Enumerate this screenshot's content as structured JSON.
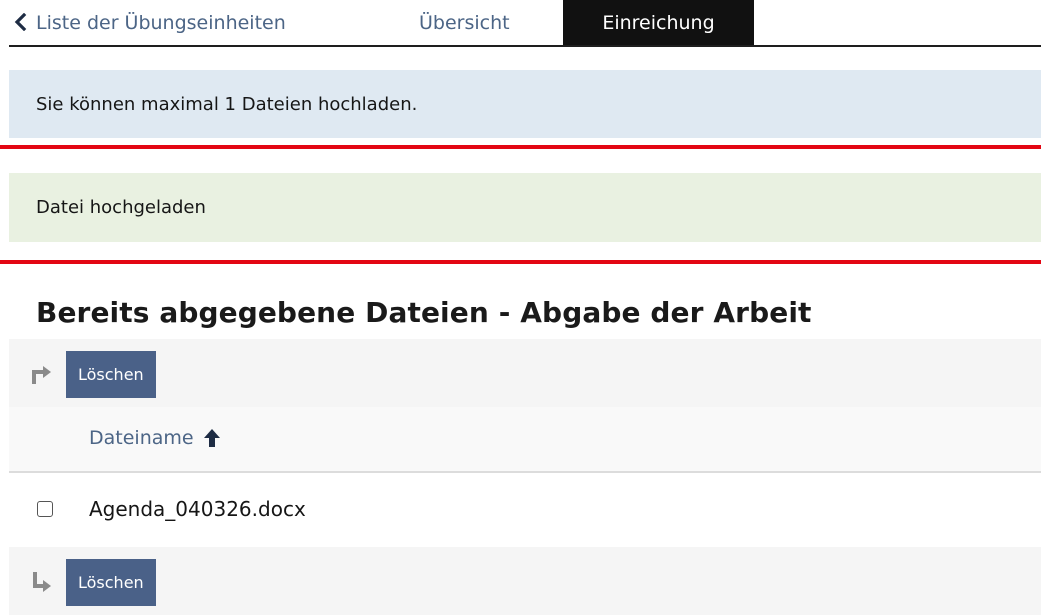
{
  "tabs": {
    "back_label": "Liste der Übungseinheiten",
    "overview_label": "Übersicht",
    "active_label": "Einreichung"
  },
  "messages": {
    "info": "Sie können maximal 1 Dateien hochladen.",
    "success": "Datei hochgeladen"
  },
  "section": {
    "title": "Bereits abgegebene Dateien - Abgabe der Arbeit"
  },
  "table": {
    "top_action_label": "Löschen",
    "bottom_action_label": "Löschen",
    "column_header": "Dateiname",
    "sort_icon": "arrow-up-icon",
    "rows": [
      {
        "filename": "Agenda_040326.docx",
        "checked": false
      }
    ]
  },
  "colors": {
    "info_bg": "#dfe9f2",
    "success_bg": "#e9f1e1",
    "alert_line": "#e30613",
    "button_bg": "#4a6188",
    "link": "#4c6586"
  }
}
